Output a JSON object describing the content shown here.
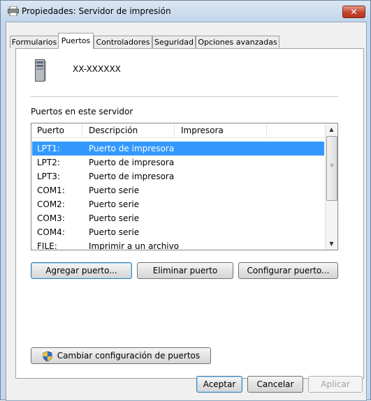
{
  "window": {
    "title": "Propiedades: Servidor de impresión",
    "close_glyph": "✕"
  },
  "tabs": [
    {
      "label": "Formularios"
    },
    {
      "label": "Puertos"
    },
    {
      "label": "Controladores"
    },
    {
      "label": "Seguridad"
    },
    {
      "label": "Opciones avanzadas"
    }
  ],
  "active_tab": "Puertos",
  "server": {
    "name": "XX-XXXXXX",
    "icon": "server-icon"
  },
  "ports": {
    "label": "Puertos en este servidor",
    "columns": [
      "Puerto",
      "Descripción",
      "Impresora"
    ],
    "rows": [
      {
        "port": "LPT1:",
        "description": "Puerto de impresora",
        "printer": ""
      },
      {
        "port": "LPT2:",
        "description": "Puerto de impresora",
        "printer": ""
      },
      {
        "port": "LPT3:",
        "description": "Puerto de impresora",
        "printer": ""
      },
      {
        "port": "COM1:",
        "description": "Puerto serie",
        "printer": ""
      },
      {
        "port": "COM2:",
        "description": "Puerto serie",
        "printer": ""
      },
      {
        "port": "COM3:",
        "description": "Puerto serie",
        "printer": ""
      },
      {
        "port": "COM4:",
        "description": "Puerto serie",
        "printer": ""
      },
      {
        "port": "FILE:",
        "description": "Imprimir a un archivo",
        "printer": ""
      }
    ],
    "selected_row": 0
  },
  "buttons": {
    "add_port": "Agregar puerto...",
    "delete_port": "Eliminar puerto",
    "configure_port": "Configurar puerto...",
    "change_settings": "Cambiar configuración de puertos",
    "ok": "Aceptar",
    "cancel": "Cancelar",
    "apply": "Aplicar"
  },
  "colors": {
    "selection": "#3399ff",
    "titlebar": "#c4d6ea",
    "close_button": "#c4452d"
  }
}
